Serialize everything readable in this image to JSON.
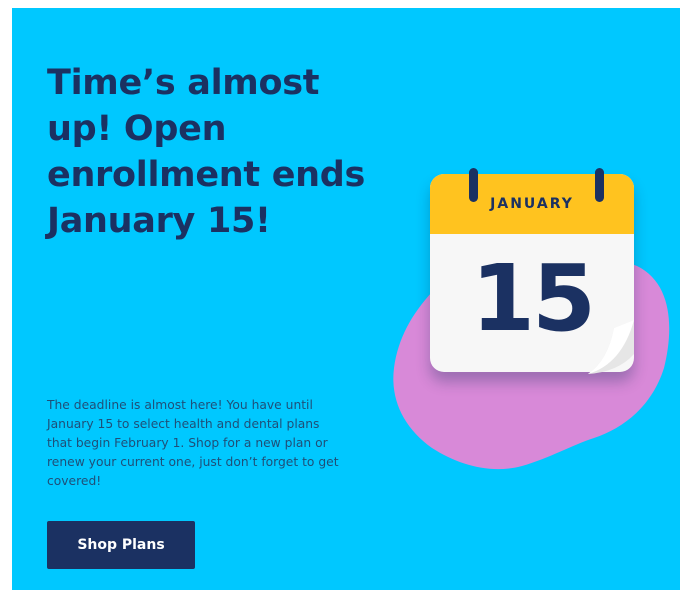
{
  "colors": {
    "background": "#00c8ff",
    "navy": "#1b3162",
    "calendar_header": "#ffc31f",
    "blob": "#d889d8"
  },
  "promo": {
    "headline": "Time’s almost up! Open enrollment ends January 15!",
    "body": "The deadline is almost here! You have until January 15 to select health and dental plans that begin February 1. Shop for a new plan or renew your current one, just don’t forget to get covered!",
    "cta_label": "Shop Plans"
  },
  "calendar": {
    "month": "JANUARY",
    "day": "15"
  }
}
